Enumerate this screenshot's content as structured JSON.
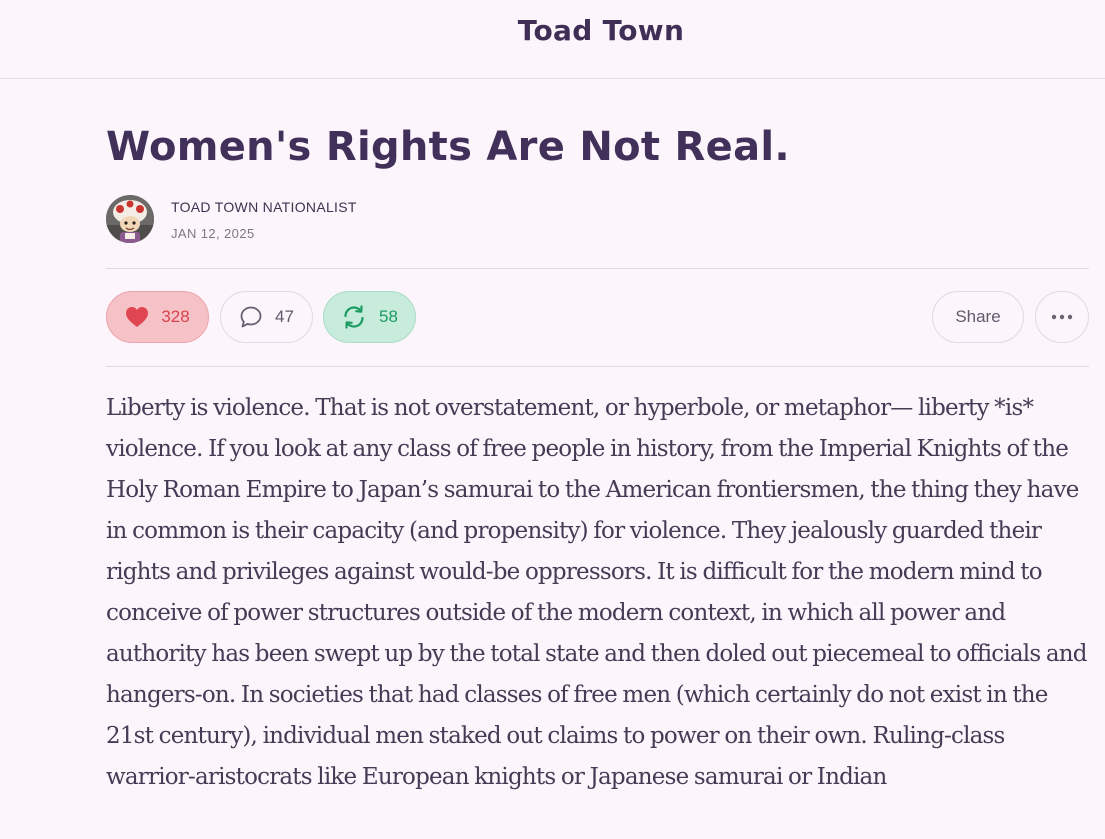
{
  "site": {
    "title": "Toad Town"
  },
  "post": {
    "title": "Women's Rights Are Not Real.",
    "author": "TOAD TOWN NATIONALIST",
    "date": "JAN 12, 2025",
    "body": "Liberty is violence. That is not overstatement, or hyperbole, or metaphor— liberty *is* violence. If you look at any class of free people in history, from the Imperial Knights of the Holy Roman Empire to Japan’s samurai to the American frontiersmen, the thing they have in common is their capacity (and propensity) for violence. They jealously guarded their rights and privileges against would-be oppressors. It is difficult for the modern mind to conceive of power structures outside of the modern context, in which all power and authority has been swept up by the total state and then doled out piecemeal to officials and hangers-on. In societies that had classes of free men (which certainly do not exist in the 21st century), individual men staked out claims to power on their own. Ruling-class warrior-aristocrats like European knights or Japanese samurai or Indian"
  },
  "actions": {
    "likes": "328",
    "comments": "47",
    "restacks": "58",
    "share_label": "Share"
  },
  "icons": {
    "like": "heart-icon",
    "comment": "speech-bubble-icon",
    "restack": "refresh-arrows-icon",
    "more": "ellipsis-icon"
  },
  "colors": {
    "background": "#fcf5fb",
    "heading": "#40305a",
    "like": "#d9424f",
    "like_bg": "#f5c2c7",
    "restack": "#1d9b62",
    "restack_bg": "#c8ecdc"
  }
}
